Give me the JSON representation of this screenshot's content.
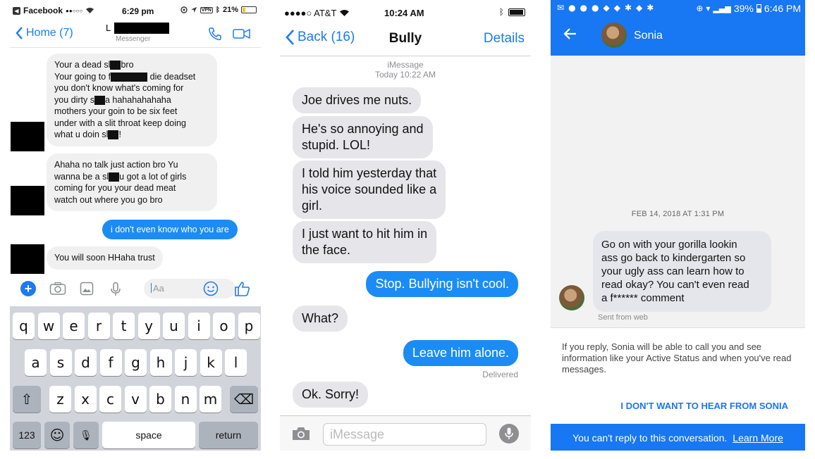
{
  "panel1": {
    "status": {
      "carrier": "Facebook",
      "signal": "●●○○○",
      "time": "6:29 pm",
      "vpn": "VPN",
      "battery": "21%",
      "battery_level": 0.21
    },
    "header": {
      "back_label": "Home (7)",
      "title_initial": "L",
      "subtitle": "Messenger"
    },
    "messages": [
      {
        "dir": "in",
        "lines": [
          [
            "Your a dead sl",
            "■",
            "bro"
          ],
          [
            "Your going to f",
            "■",
            " die deadset"
          ],
          [
            "you don't know what's coming for"
          ],
          [
            "you dirty s",
            "■",
            "a hahahahahaha"
          ],
          [
            "mothers your goin to be six feet"
          ],
          [
            "under with a slit throat keep doing"
          ],
          [
            "what u doin sl",
            "■",
            "!"
          ]
        ]
      },
      {
        "dir": "in",
        "lines": [
          [
            "Ahaha no talk just action bro Yu"
          ],
          [
            "wanna be a sl",
            "■",
            "u got a lot of girls"
          ],
          [
            "coming for you your dead meat"
          ],
          [
            "watch out where you go bro"
          ]
        ]
      },
      {
        "dir": "out",
        "text": "i don't even know who you are"
      },
      {
        "dir": "in",
        "text": "You will soon HHaha trust"
      }
    ],
    "input_placeholder": "Aa",
    "keyboard": {
      "row1": [
        "q",
        "w",
        "e",
        "r",
        "t",
        "y",
        "u",
        "i",
        "o",
        "p"
      ],
      "row2": [
        "a",
        "s",
        "d",
        "f",
        "g",
        "h",
        "j",
        "k",
        "l"
      ],
      "row3": [
        "z",
        "x",
        "c",
        "v",
        "b",
        "n",
        "m"
      ],
      "shift": "⇧",
      "delete": "⌫",
      "num": "123",
      "emoji": "☺",
      "mic": "🎙",
      "space": "space",
      "return": "return"
    }
  },
  "panel2": {
    "status": {
      "carrier": "●●●●○ AT&T",
      "time": "10:24 AM"
    },
    "header": {
      "back_label": "Back (16)",
      "title": "Bully",
      "details_label": "Details"
    },
    "service": "iMessage",
    "timestamp": "Today 10:22 AM",
    "messages": [
      {
        "dir": "in",
        "text": "Joe drives me nuts."
      },
      {
        "dir": "in",
        "text": "He's so annoying and\nstupid. LOL!"
      },
      {
        "dir": "in",
        "text": "I told him yesterday that\nhis voice sounded like a\ngirl."
      },
      {
        "dir": "in",
        "text": "I just want to hit him in\nthe face."
      },
      {
        "dir": "out",
        "text": "Stop. Bullying isn't cool."
      },
      {
        "dir": "in",
        "text": "What?"
      },
      {
        "dir": "out",
        "text": "Leave him alone."
      },
      {
        "dir": "in",
        "text": "Ok. Sorry!"
      }
    ],
    "delivered": "Delivered",
    "input_placeholder": "iMessage"
  },
  "panel3": {
    "status": {
      "battery": "39%",
      "time": "6:46 PM"
    },
    "header": {
      "contact_name": "Sonia"
    },
    "date": "FEB 14, 2018 AT 1:31 PM",
    "message": "Go on with your gorilla lookin\nass  go  back to kindergarten so\nyour ugly ass can learn how to\nread okay? You can't even read\na f****** comment",
    "sent_from": "Sent from web",
    "notice": "If you reply, Sonia will be able to call you and see information like your Active Status and when you've read messages.",
    "block_button": "I DON'T WANT TO HEAR FROM SONIA",
    "footer_text": "You can't reply to this conversation.",
    "footer_link": "Learn More"
  },
  "colors": {
    "messenger_blue": "#1b8cf5",
    "imessage_gray": "#e5e5ea",
    "facebook_blue": "#1877f2"
  }
}
